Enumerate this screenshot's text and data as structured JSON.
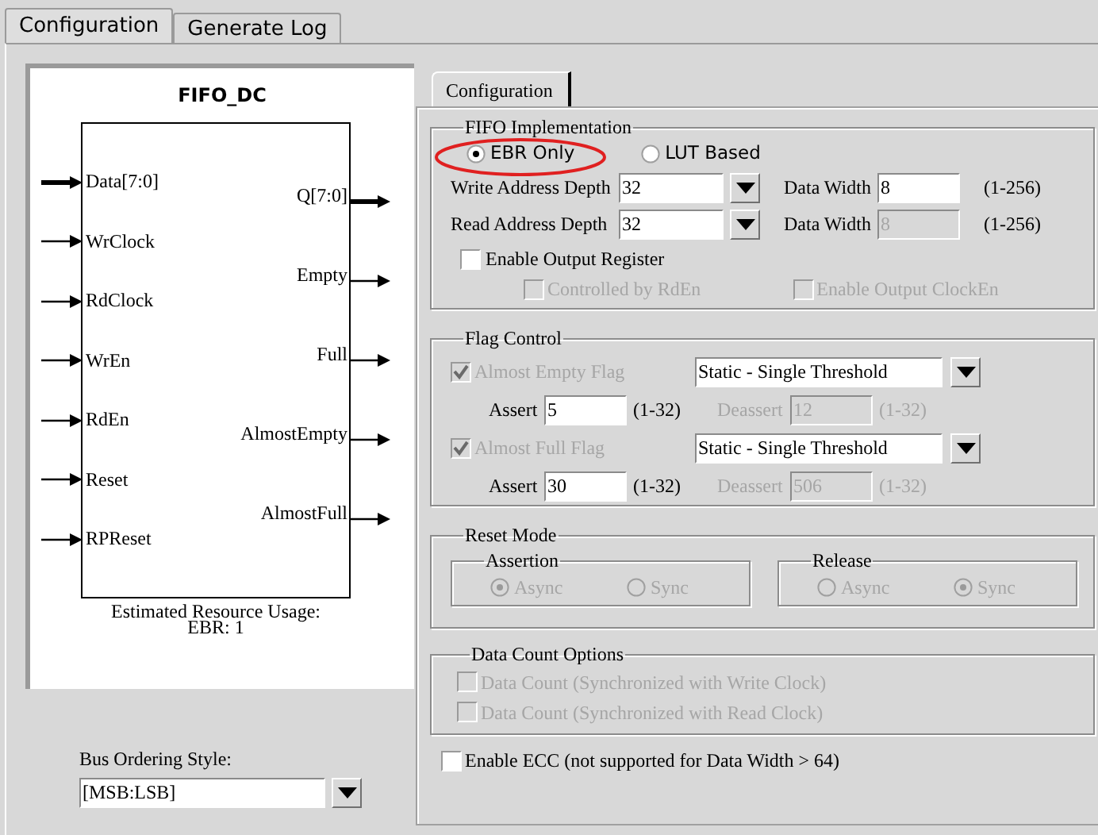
{
  "tabs": [
    {
      "label": "Configuration",
      "selected": true
    },
    {
      "label": "Generate Log",
      "selected": false
    }
  ],
  "diagram": {
    "title": "FIFO_DC",
    "inputs": [
      {
        "label": "Data[7:0]",
        "bus": true
      },
      {
        "label": "WrClock",
        "bus": false
      },
      {
        "label": "RdClock",
        "bus": false
      },
      {
        "label": "WrEn",
        "bus": false
      },
      {
        "label": "RdEn",
        "bus": false
      },
      {
        "label": "Reset",
        "bus": false
      },
      {
        "label": "RPReset",
        "bus": false
      }
    ],
    "outputs": [
      {
        "label": "Q[7:0]",
        "bus": true
      },
      {
        "label": "Empty",
        "bus": false
      },
      {
        "label": "Full",
        "bus": false
      },
      {
        "label": "AlmostEmpty",
        "bus": false
      },
      {
        "label": "AlmostFull",
        "bus": false
      }
    ],
    "usage": [
      "Estimated Resource Usage:",
      "EBR: 1"
    ]
  },
  "bus_ordering": {
    "label": "Bus Ordering Style:",
    "value": "[MSB:LSB]"
  },
  "config_tabs": [
    {
      "label": "Configuration",
      "selected": true
    }
  ],
  "fifo_implementation": {
    "title": "FIFO Implementation",
    "options": [
      {
        "label": "EBR Only",
        "selected": true,
        "highlighted": true
      },
      {
        "label": "LUT Based",
        "selected": false,
        "highlighted": false
      }
    ],
    "depth_rows": [
      {
        "label": "Write Address Depth",
        "value": "32",
        "width_label": "Data Width",
        "width_value": "8",
        "width_disabled": false,
        "range": "(1-256)"
      },
      {
        "label": "Read Address Depth",
        "value": "32",
        "width_label": "Data Width",
        "width_value": "8",
        "width_disabled": true,
        "range": "(1-256)"
      }
    ],
    "output_register": {
      "label": "Enable Output Register",
      "checked": false
    },
    "sub_options": [
      {
        "label": "Controlled by RdEn",
        "checked": false,
        "disabled": true
      },
      {
        "label": "Enable Output ClockEn",
        "checked": false,
        "disabled": true
      }
    ]
  },
  "flag_control": {
    "title": "Flag Control",
    "flags": [
      {
        "label": "Almost Empty Flag",
        "checked": true,
        "disabled": true,
        "mode": "Static - Single Threshold",
        "assert_label": "Assert",
        "assert_value": "5",
        "assert_range": "(1-32)",
        "deassert_label": "Deassert",
        "deassert_value": "12",
        "deassert_range": "(1-32)"
      },
      {
        "label": "Almost Full Flag",
        "checked": true,
        "disabled": true,
        "mode": "Static - Single Threshold",
        "assert_label": "Assert",
        "assert_value": "30",
        "assert_range": "(1-32)",
        "deassert_label": "Deassert",
        "deassert_value": "506",
        "deassert_range": "(1-32)"
      }
    ]
  },
  "reset_mode": {
    "title": "Reset Mode",
    "disabled": true,
    "groups": [
      {
        "title": "Assertion",
        "options": [
          {
            "label": "Async",
            "selected": true
          },
          {
            "label": "Sync",
            "selected": false
          }
        ]
      },
      {
        "title": "Release",
        "options": [
          {
            "label": "Async",
            "selected": false
          },
          {
            "label": "Sync",
            "selected": true
          }
        ]
      }
    ]
  },
  "data_count": {
    "title": "Data Count Options",
    "options": [
      {
        "label": "Data Count (Synchronized with Write Clock)",
        "checked": false,
        "disabled": true
      },
      {
        "label": "Data Count (Synchronized with Read Clock)",
        "checked": false,
        "disabled": true
      }
    ]
  },
  "ecc": {
    "label": "Enable ECC (not supported for Data Width > 64)",
    "checked": false
  }
}
